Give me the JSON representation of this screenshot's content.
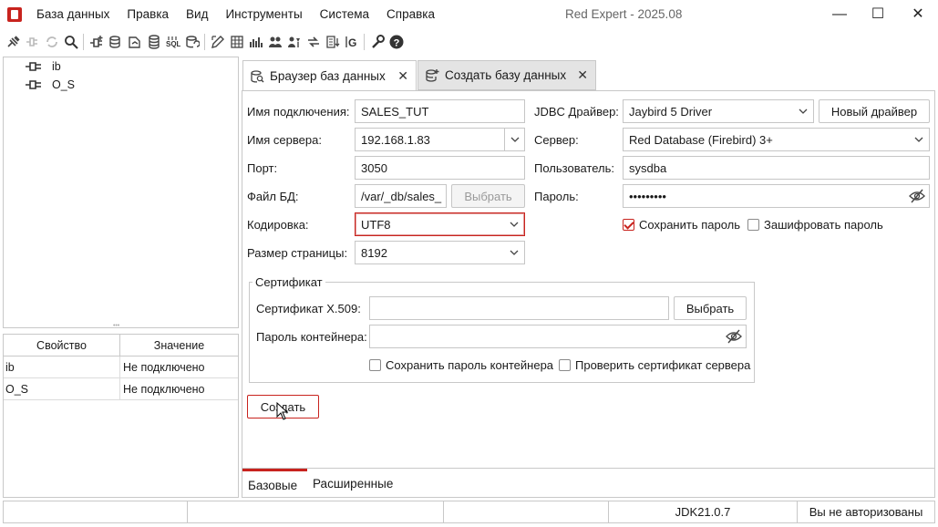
{
  "app": {
    "window_title": "Red Expert - 2025.08",
    "menu": [
      "База данных",
      "Правка",
      "Вид",
      "Инструменты",
      "Система",
      "Справка"
    ],
    "minimize": "—",
    "maximize": "☐",
    "close": "✕"
  },
  "toolbar": {
    "icons": [
      "connect-icon",
      "disconnect-icon",
      "reconnect-icon",
      "search-icon",
      "new-connection-icon",
      "create-database-icon",
      "open-file-icon",
      "database-icon",
      "sql-editor-icon",
      "refresh-database-icon",
      "edit-icon",
      "table-icon",
      "statistics-icon",
      "users-icon",
      "grant-manager-icon",
      "transfer-icon",
      "export-icon",
      "generator-icon",
      "settings-icon",
      "help-icon"
    ]
  },
  "tree": {
    "items": [
      "ib",
      "O_S"
    ]
  },
  "properties": {
    "header_property": "Свойство",
    "header_value": "Значение",
    "rows": [
      {
        "name": "ib",
        "value": "Не подключено"
      },
      {
        "name": "O_S",
        "value": "Не подключено"
      }
    ]
  },
  "tabs": [
    {
      "label": "Браузер баз данных",
      "active": true
    },
    {
      "label": "Создать базу данных",
      "active": false
    }
  ],
  "form": {
    "connection_name_label": "Имя подключения:",
    "connection_name_value": "SALES_TUT",
    "server_name_label": "Имя сервера:",
    "server_name_value": "192.168.1.83",
    "port_label": "Порт:",
    "port_value": "3050",
    "db_file_label": "Файл БД:",
    "db_file_value": "/var/_db/sales_",
    "browse_label": "Выбрать",
    "encoding_label": "Кодировка:",
    "encoding_value": "UTF8",
    "page_size_label": "Размер страницы:",
    "page_size_value": "8192",
    "jdbc_label": "JDBC Драйвер:",
    "jdbc_value": "Jaybird 5 Driver",
    "new_driver_label": "Новый драйвер",
    "server_label": "Сервер:",
    "server_value": "Red Database (Firebird) 3+",
    "user_label": "Пользователь:",
    "user_value": "sysdba",
    "password_label": "Пароль:",
    "password_value": "•••••••••",
    "save_password_label": "Сохранить пароль",
    "save_password_checked": true,
    "encrypt_password_label": "Зашифровать пароль",
    "encrypt_password_checked": false
  },
  "certificate": {
    "group_title": "Сертификат",
    "x509_label": "Сертификат X.509:",
    "x509_value": "",
    "browse_label": "Выбрать",
    "container_password_label": "Пароль контейнера:",
    "container_password_value": "",
    "save_container_password_label": "Сохранить пароль контейнера",
    "verify_server_cert_label": "Проверить сертификат сервера"
  },
  "create_button_label": "Создать",
  "subtabs": [
    {
      "label": "Базовые",
      "active": true
    },
    {
      "label": "Расширенные",
      "active": false
    }
  ],
  "statusbar": {
    "cell1": "",
    "cell2": "",
    "cell3": "",
    "jdk": "JDK21.0.7",
    "auth": "Вы не авторизованы"
  },
  "colors": {
    "accent": "#c8231e",
    "border": "#c8c8c8",
    "inactive_tab": "#e4e4e4"
  }
}
